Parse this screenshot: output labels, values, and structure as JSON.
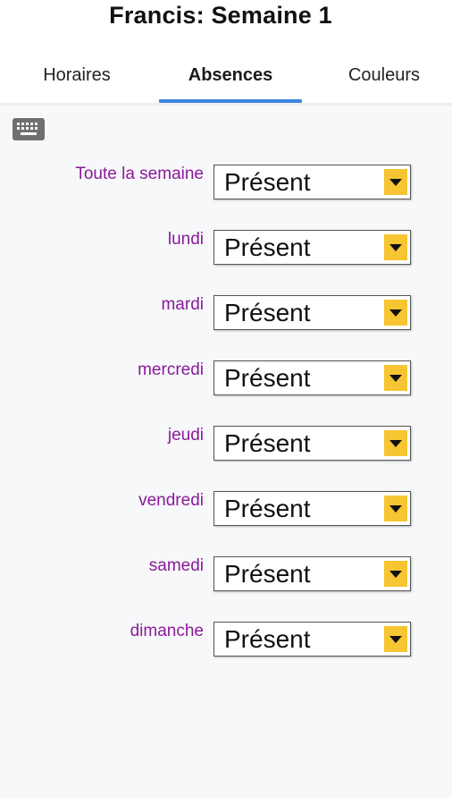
{
  "header": {
    "title": "Francis: Semaine 1",
    "tabs": [
      {
        "label": "Horaires"
      },
      {
        "label": "Absences"
      },
      {
        "label": "Couleurs"
      }
    ],
    "active_tab": "Absences",
    "accent_color": "#3d86e0"
  },
  "toolbar": {
    "keyboard_icon": "keyboard-icon"
  },
  "absences": {
    "label_color": "#8a1a9b",
    "dropdown_arrow_color": "#f7c531",
    "rows": [
      {
        "label": "Toute la semaine",
        "value": "Présent"
      },
      {
        "label": "lundi",
        "value": "Présent"
      },
      {
        "label": "mardi",
        "value": "Présent"
      },
      {
        "label": "mercredi",
        "value": "Présent"
      },
      {
        "label": "jeudi",
        "value": "Présent"
      },
      {
        "label": "vendredi",
        "value": "Présent"
      },
      {
        "label": "samedi",
        "value": "Présent"
      },
      {
        "label": "dimanche",
        "value": "Présent"
      }
    ]
  }
}
